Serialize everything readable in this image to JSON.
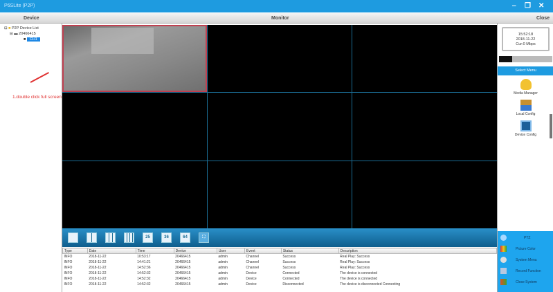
{
  "window": {
    "title": "P6SLite (P2P)",
    "min": "‒",
    "restore": "❐",
    "close": "✕"
  },
  "header": {
    "device": "Device",
    "monitor": "Monitor",
    "close": "Close"
  },
  "tree": {
    "root": "P2P Device List",
    "device": "20466415",
    "channel": "CH1"
  },
  "annotation": "1.double click full screen",
  "toolbar": {
    "buttons": [
      "1",
      "4",
      "9",
      "16",
      "25",
      "36",
      "64",
      "full"
    ],
    "labels": {
      "25": "25",
      "36": "36",
      "64": "64"
    }
  },
  "log": {
    "columns": [
      "Type",
      "Date",
      "Time",
      "Device",
      "User",
      "Event",
      "Status",
      "Description"
    ],
    "rows": [
      [
        "INFO",
        "2018-11-22",
        "10:53:17",
        "20466415",
        "admin",
        "Channel",
        "Success",
        "Real Play: Success"
      ],
      [
        "INFO",
        "2018-11-22",
        "14:41:21",
        "20466415",
        "admin",
        "Channel",
        "Success",
        "Real Play: Success"
      ],
      [
        "INFO",
        "2018-11-22",
        "14:52:36",
        "20466415",
        "admin",
        "Channel",
        "Success",
        "Real Play: Success"
      ],
      [
        "INFO",
        "2018-11-22",
        "14:52:32",
        "20466415",
        "admin",
        "Device",
        "Connected",
        "The device is connected"
      ],
      [
        "INFO",
        "2018-11-22",
        "14:52:32",
        "20466415",
        "admin",
        "Device",
        "Connected",
        "The device is connected"
      ],
      [
        "INFO",
        "2018-11-22",
        "14:52:32",
        "20466415",
        "admin",
        "Device",
        "Disconnected",
        "The device is disconnected Connecting"
      ]
    ]
  },
  "right": {
    "time": "15:52:18",
    "date": "2018-11-22",
    "rate": "Cur:0 Mbps",
    "progress": 0.25,
    "menu_title": "Select Menu",
    "menu": [
      "Media Manager",
      "Local Config",
      "Device Config"
    ],
    "bottom": [
      "PTZ",
      "Picture Color",
      "System Menu",
      "Record Function",
      "Close System"
    ]
  }
}
